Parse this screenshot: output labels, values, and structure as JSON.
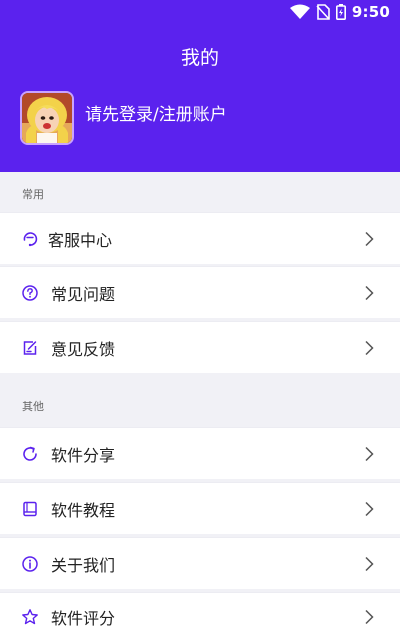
{
  "status": {
    "time": "9:50"
  },
  "header": {
    "title": "我的",
    "login_prompt": "请先登录/注册账户"
  },
  "sections": [
    {
      "label": "常用",
      "items": [
        {
          "label": "客服中心",
          "icon": "support-icon"
        },
        {
          "label": "常见问题",
          "icon": "question-icon"
        },
        {
          "label": "意见反馈",
          "icon": "feedback-icon"
        }
      ]
    },
    {
      "label": "其他",
      "items": [
        {
          "label": "软件分享",
          "icon": "share-icon"
        },
        {
          "label": "软件教程",
          "icon": "tutorial-icon"
        },
        {
          "label": "关于我们",
          "icon": "info-icon"
        },
        {
          "label": "软件评分",
          "icon": "star-icon"
        }
      ]
    }
  ],
  "colors": {
    "brand": "#5b22ee",
    "icon": "#5b22ee",
    "background": "#f1f1f6"
  }
}
